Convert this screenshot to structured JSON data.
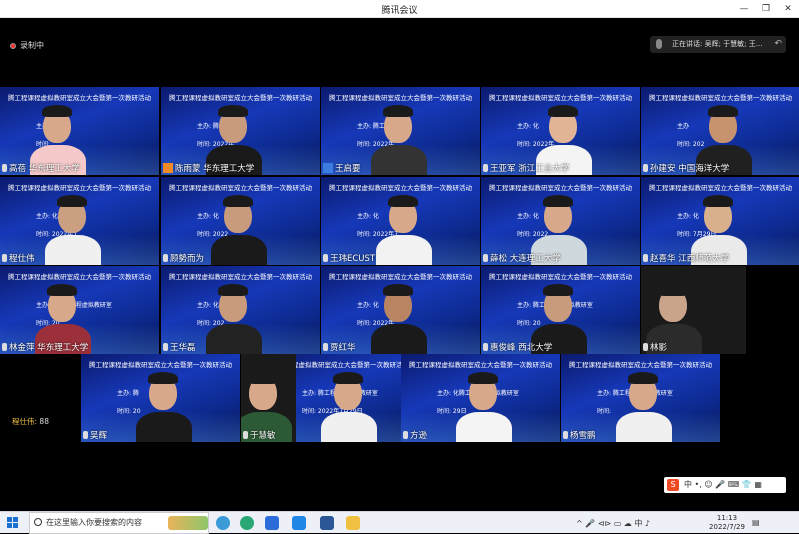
{
  "window": {
    "title": "腾讯会议",
    "controls": [
      "—",
      "❐",
      "✕"
    ]
  },
  "recording": {
    "label": "录制中"
  },
  "speaking": {
    "label": "正在讲话: 吴辉; 于慧敏; 王..."
  },
  "banner_text": "腾工程课程虚拟教研室成立大会暨第一次教研活动",
  "banner_text_alt": "腾工程课程虚拟教研室",
  "participants": [
    {
      "name": "高蓓 华东理工大学",
      "sub1": "主办: ",
      "sub2": "时间:"
    },
    {
      "name": "陈雨蒙 华东理工大学",
      "sub1": "主办: 腾工",
      "sub2": "时间: 2022年"
    },
    {
      "name": "王启要",
      "sub1": "主办: 腾工程",
      "sub2": "时间: 2022年"
    },
    {
      "name": "王亚军 浙江工业大学",
      "sub1": "主办: 化",
      "sub2": "时间: 2022年"
    },
    {
      "name": "孙建安 中国海洋大学",
      "sub1": "主办",
      "sub2": "时间: 202"
    },
    {
      "name": "程仕伟",
      "sub1": "主办: 化",
      "sub2": "时间: 2022年7"
    },
    {
      "name": "顾勢而为",
      "sub1": "主办: 化",
      "sub2": "时间: 2022"
    },
    {
      "name": "王玮ECUST",
      "sub1": "主办: 化",
      "sub2": "时间: 2022年7"
    },
    {
      "name": "薛松 大连理工大学",
      "sub1": "主办: 化",
      "sub2": "时间: 2022"
    },
    {
      "name": "赵喜华 江西师范大学",
      "sub1": "主办: 化",
      "sub2": "时间: 7月29日"
    },
    {
      "name": "林金萍 华东理工大学",
      "sub1": "主办: 腾工程课程虚拟教研室",
      "sub2": "时间: 20"
    },
    {
      "name": "王华磊",
      "sub1": "主办: 化",
      "sub2": "时间: 202"
    },
    {
      "name": "贾红华",
      "sub1": "主办: 化",
      "sub2": "时间: 2022年"
    },
    {
      "name": "惠俊峰 西北大学",
      "sub1": "主办: 腾工程课程虚拟教研室",
      "sub2": "时间: 20"
    },
    {
      "name": "林影",
      "sub1": "",
      "sub2": ""
    },
    {
      "name": "吴辉",
      "sub1": "主办: 腾",
      "sub2": "时间: 20"
    },
    {
      "name": "于慧敏",
      "sub1": "",
      "sub2": ""
    },
    {
      "name": "",
      "sub1": "主办: 腾工程课程虚拟教研室",
      "sub2": "时间: 2022年7月29日"
    },
    {
      "name": "方逊",
      "sub1": "主办: 化腾工程课程虚拟教研室",
      "sub2": "时间: 29日"
    },
    {
      "name": "杨雪鹏",
      "sub1": "主办: 腾工程课程虚拟教研室",
      "sub2": "时间:"
    }
  ],
  "side_label": {
    "name": "程仕伟:",
    "count": "88"
  },
  "ime": {
    "logo": "S",
    "text": "中 •, ☺ 🎤 ⌨ 👕 ▦"
  },
  "taskbar": {
    "search_placeholder": "在这里输入你要搜索的内容",
    "clock_time": "11:13",
    "clock_date": "2022/7/29",
    "tray_text": "^ 🎤 ⊲⊳ ▭ ☁ 中 ♪"
  },
  "colors": {
    "tile_blue": "#1638b8",
    "recording_dot": "#e33",
    "side_label": "#f0c040"
  }
}
